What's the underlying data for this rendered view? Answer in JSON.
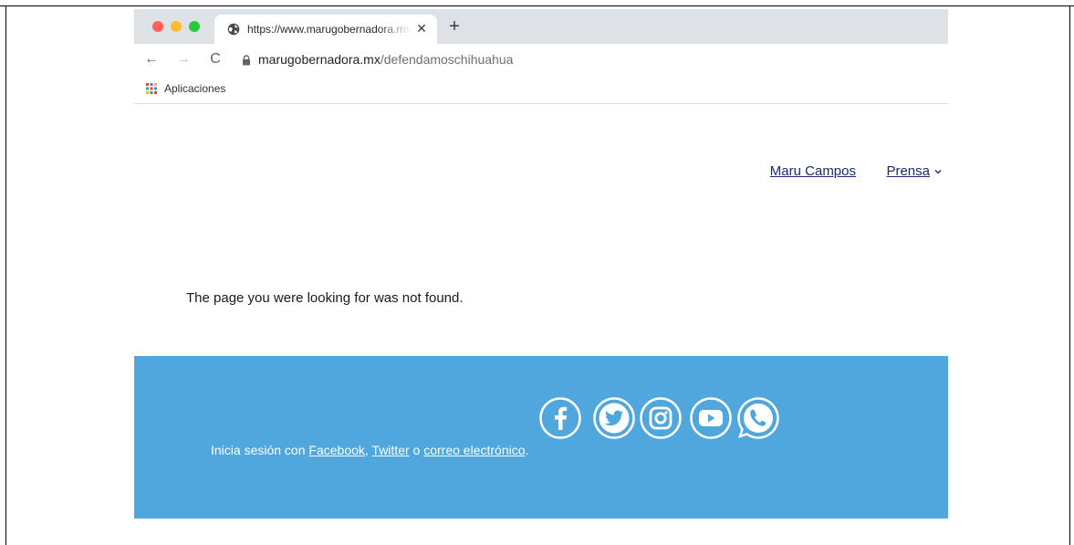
{
  "browser": {
    "tab_title": "https://www.marugobernadora.mx/defendamoschihuahua",
    "tab_close": "✕",
    "new_tab": "+",
    "nav_back": "←",
    "nav_forward": "→",
    "nav_reload": "C",
    "url_host": "marugobernadora.mx",
    "url_path": "/defendamoschihuahua",
    "bookmark_apps": "Aplicaciones"
  },
  "site": {
    "nav": [
      {
        "label": "Maru Campos"
      },
      {
        "label": "Prensa"
      }
    ],
    "message": "The page you were looking for was not found.",
    "footer": {
      "social_icons": [
        "facebook-icon",
        "twitter-icon",
        "instagram-icon",
        "youtube-icon",
        "whatsapp-icon"
      ],
      "login_prefix": "Inicia sesión con ",
      "login_facebook": "Facebook",
      "login_sep": ", ",
      "login_twitter": "Twitter",
      "login_or": " o ",
      "login_email": "correo electrónico",
      "login_end": "."
    }
  },
  "colors": {
    "footer_bg": "#4fa7de",
    "nav_link": "#1b2b6e",
    "tabbar_bg": "#dee1e6"
  }
}
